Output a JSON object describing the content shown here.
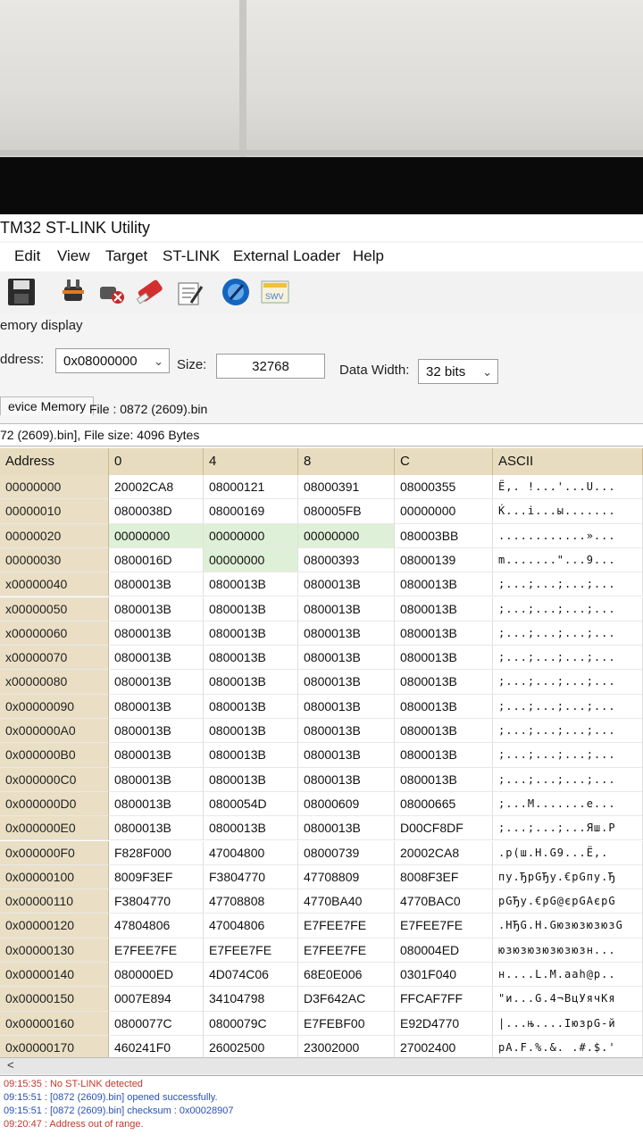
{
  "window": {
    "title": "TM32 ST-LINK Utility"
  },
  "menu": [
    "Edit",
    "View",
    "Target",
    "ST-LINK",
    "External Loader",
    "Help"
  ],
  "toolbar": {
    "icons": [
      "save-icon",
      "connect-icon",
      "disconnect-icon",
      "erase-icon",
      "program-icon",
      "update-icon",
      "swv-icon"
    ]
  },
  "memory_display": {
    "group_label": "emory display",
    "address_label": "ddress:",
    "address_value": "0x08000000",
    "size_label": "Size:",
    "size_value": "32768",
    "data_width_label": "Data Width:",
    "data_width_value": "32 bits"
  },
  "tabs": [
    {
      "label": "evice Memory"
    },
    {
      "label": "File : 0872 (2609).bin"
    }
  ],
  "file_info": "72 (2609).bin], File size: 4096 Bytes",
  "grid": {
    "headers": [
      "Address",
      "0",
      "4",
      "8",
      "C",
      "ASCII"
    ],
    "rows": [
      {
        "addr": "00000000",
        "c0": "20002CA8",
        "c4": "08000121",
        "c8": "08000391",
        "cc": "08000355",
        "ascii": "Ё,. !...'...U..."
      },
      {
        "addr": "00000010",
        "c0": "0800038D",
        "c4": "08000169",
        "c8": "080005FB",
        "cc": "00000000",
        "ascii": "Ќ...i...ы......."
      },
      {
        "addr": "00000020",
        "c0": "00000000",
        "c4": "00000000",
        "c8": "00000000",
        "cc": "080003BB",
        "ascii": "............»..."
      },
      {
        "addr": "00000030",
        "c0": "0800016D",
        "c4": "00000000",
        "c8": "08000393",
        "cc": "08000139",
        "ascii": "m.......\"...9..."
      },
      {
        "addr": "x00000040",
        "c0": "0800013B",
        "c4": "0800013B",
        "c8": "0800013B",
        "cc": "0800013B",
        "ascii": ";...;...;...;..."
      },
      {
        "addr": "x00000050",
        "c0": "0800013B",
        "c4": "0800013B",
        "c8": "0800013B",
        "cc": "0800013B",
        "ascii": ";...;...;...;..."
      },
      {
        "addr": "x00000060",
        "c0": "0800013B",
        "c4": "0800013B",
        "c8": "0800013B",
        "cc": "0800013B",
        "ascii": ";...;...;...;..."
      },
      {
        "addr": "x00000070",
        "c0": "0800013B",
        "c4": "0800013B",
        "c8": "0800013B",
        "cc": "0800013B",
        "ascii": ";...;...;...;..."
      },
      {
        "addr": "x00000080",
        "c0": "0800013B",
        "c4": "0800013B",
        "c8": "0800013B",
        "cc": "0800013B",
        "ascii": ";...;...;...;..."
      },
      {
        "addr": "0x00000090",
        "c0": "0800013B",
        "c4": "0800013B",
        "c8": "0800013B",
        "cc": "0800013B",
        "ascii": ";...;...;...;..."
      },
      {
        "addr": "0x000000A0",
        "c0": "0800013B",
        "c4": "0800013B",
        "c8": "0800013B",
        "cc": "0800013B",
        "ascii": ";...;...;...;..."
      },
      {
        "addr": "0x000000B0",
        "c0": "0800013B",
        "c4": "0800013B",
        "c8": "0800013B",
        "cc": "0800013B",
        "ascii": ";...;...;...;..."
      },
      {
        "addr": "0x000000C0",
        "c0": "0800013B",
        "c4": "0800013B",
        "c8": "0800013B",
        "cc": "0800013B",
        "ascii": ";...;...;...;..."
      },
      {
        "addr": "0x000000D0",
        "c0": "0800013B",
        "c4": "0800054D",
        "c8": "08000609",
        "cc": "08000665",
        "ascii": ";...M.......e..."
      },
      {
        "addr": "0x000000E0",
        "c0": "0800013B",
        "c4": "0800013B",
        "c8": "0800013B",
        "cc": "D00CF8DF",
        "ascii": ";...;...;...Яш.Р"
      },
      {
        "addr": "0x000000F0",
        "c0": "F828F000",
        "c4": "47004800",
        "c8": "08000739",
        "cc": "20002CA8",
        "ascii": ".р(ш.H.G9...Ё,."
      },
      {
        "addr": "0x00000100",
        "c0": "8009F3EF",
        "c4": "F3804770",
        "c8": "47708809",
        "cc": "8008F3EF",
        "ascii": "пу.ЂрGЂу.€рGпу.Ђ"
      },
      {
        "addr": "0x00000110",
        "c0": "F3804770",
        "c4": "47708808",
        "c8": "4770BA40",
        "cc": "4770BAC0",
        "ascii": "рGЂу.€рG@єрGАєрG"
      },
      {
        "addr": "0x00000120",
        "c0": "47804806",
        "c4": "47004806",
        "c8": "E7FEE7FE",
        "cc": "E7FEE7FE",
        "ascii": ".HЂG.H.GюзюзюзюзG"
      },
      {
        "addr": "0x00000130",
        "c0": "E7FEE7FE",
        "c4": "E7FEE7FE",
        "c8": "E7FEE7FE",
        "cc": "080004ED",
        "ascii": "юзюзюзюзюзюзн..."
      },
      {
        "addr": "0x00000140",
        "c0": "080000ED",
        "c4": "4D074C06",
        "c8": "68E0E006",
        "cc": "0301F040",
        "ascii": "н....L.M.aah@р.."
      },
      {
        "addr": "0x00000150",
        "c0": "0007E894",
        "c4": "34104798",
        "c8": "D3F642AC",
        "cc": "FFCAF7FF",
        "ascii": "\"и...G.4¬BцУячКя"
      },
      {
        "addr": "0x00000160",
        "c0": "0800077C",
        "c4": "0800079C",
        "c8": "E7FEBF00",
        "cc": "E92D4770",
        "ascii": "|...њ....ІюзрG-й"
      },
      {
        "addr": "0x00000170",
        "c0": "460241F0",
        "c4": "26002500",
        "c8": "23002000",
        "cc": "27002400",
        "ascii": "рA.F.%.&. .#.$.'"
      }
    ]
  },
  "log": [
    {
      "text": "09:15:35 : No ST-LINK detected",
      "color": "#c0392b"
    },
    {
      "text": "09:15:51 : [0872 (2609).bin] opened successfully.",
      "color": "#2a4fb3"
    },
    {
      "text": "09:15:51 : [0872 (2609).bin] checksum : 0x00028907",
      "color": "#2a4fb3"
    },
    {
      "text": "09:20:47 : Address out of range.",
      "color": "#c0392b"
    }
  ]
}
